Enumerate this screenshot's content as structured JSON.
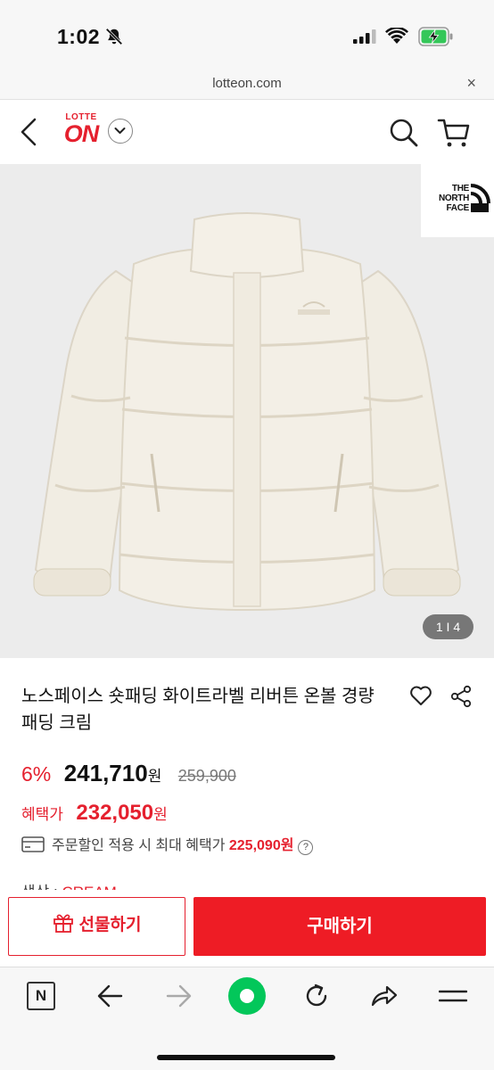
{
  "status": {
    "time": "1:02"
  },
  "browser": {
    "url": "lotteon.com",
    "close_glyph": "×"
  },
  "header": {
    "logo_top": "LOTTE",
    "logo_main": "ON"
  },
  "product": {
    "brand_lines": [
      "THE",
      "NORTH",
      "FACE"
    ],
    "image_counter": "1 I 4",
    "title": "노스페이스 숏패딩 화이트라벨 리버튼 온볼 경량 패딩 크림",
    "discount": "6%",
    "price": "241,710",
    "currency": "원",
    "original_price": "259,900",
    "benefit_label": "혜택가",
    "benefit_price": "232,050",
    "card_text": "주문할인 적용 시 최대 혜택가",
    "card_max_price": "225,090원",
    "question_glyph": "?",
    "color_label": "색상 : ",
    "color_value": "CREAM"
  },
  "actions": {
    "gift_label": "선물하기",
    "buy_label": "구매하기"
  },
  "browser_bar": {
    "n_label": "N"
  },
  "colors": {
    "accent": "#e5202e",
    "buy_bg": "#ee1c25",
    "naver_green": "#03c75a",
    "image_bg": "#ececec"
  },
  "icons": [
    "bell-slash-icon",
    "signal-icon",
    "wifi-icon",
    "battery-charging-icon",
    "close-icon",
    "back-icon",
    "chevron-down-icon",
    "search-icon",
    "cart-icon",
    "heart-icon",
    "share-icon",
    "card-icon",
    "question-icon",
    "gift-icon",
    "naver-n-icon",
    "arrow-left-icon",
    "arrow-right-icon",
    "green-dot-icon",
    "reload-icon",
    "share-arrow-icon",
    "menu-icon"
  ]
}
